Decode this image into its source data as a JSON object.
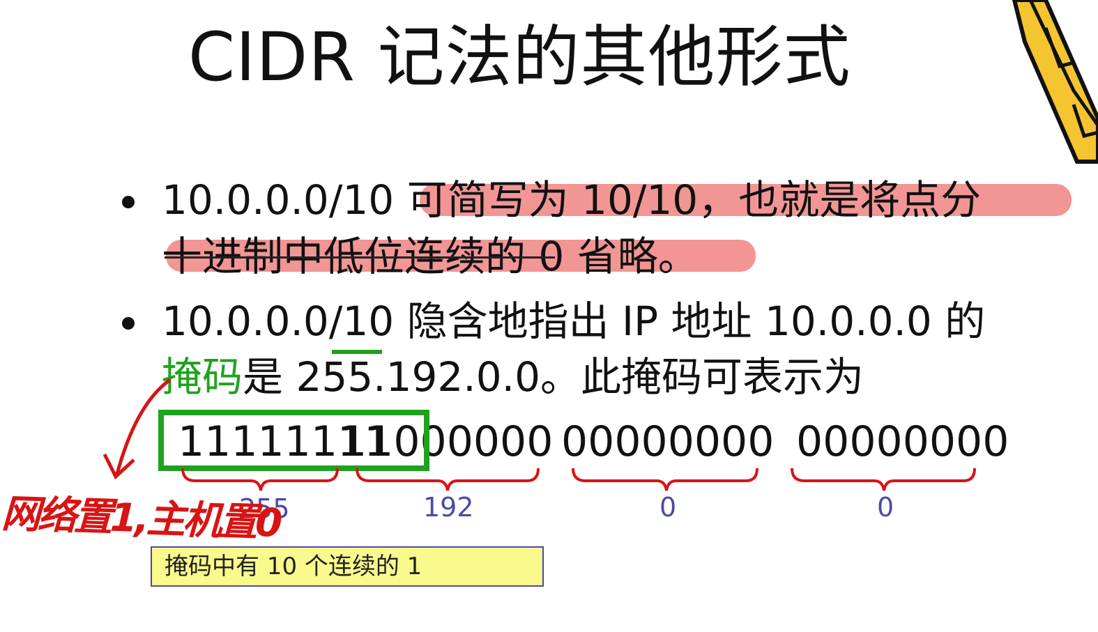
{
  "title": "CIDR 记法的其他形式",
  "bullets": [
    {
      "line1_prefix": "10.0.0.0/10 ",
      "line1_rest": "可简写为 10/10，也就是将点分",
      "line2": "十进制中低位连续的 0 省略。"
    },
    {
      "line1": "10.0.0.0/10 隐含地指出 IP 地址 10.0.0.0 的",
      "line2_green": "掩码",
      "line2_rest": "是 255.192.0.0。此掩码可表示为"
    }
  ],
  "binary": {
    "octet1": "11111111",
    "octet2": "11000000",
    "octet3": "00000000",
    "octet4": "00000000"
  },
  "octet_labels": [
    "255",
    "192",
    "0",
    "0"
  ],
  "note": "掩码中有 10 个连续的 1",
  "handwritten": "网络置1,主机置0",
  "colors": {
    "highlight": "#f08282",
    "green": "#1fa21f",
    "red_ink": "#d81414",
    "label_blue": "#4a4aa8",
    "note_bg": "#fafa8c"
  }
}
